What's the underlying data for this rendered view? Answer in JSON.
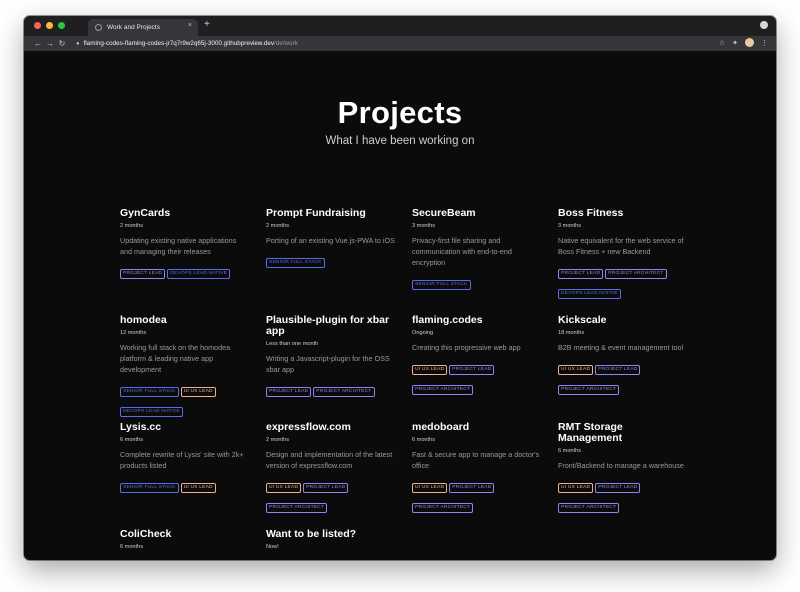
{
  "browser": {
    "tab_title": "Work and Projects",
    "new_tab": "+",
    "tab_close": "×",
    "url_host": "flaming-codes-flaming-codes-jr7q7r9w2q65j-3000.githubpreview.dev",
    "url_path": "/de/work",
    "nav_back": "←",
    "nav_forward": "→",
    "nav_reload": "↻",
    "lock": "🔒",
    "star": "☆",
    "extensions": "✦",
    "menu": "⋮"
  },
  "hero": {
    "title": "Projects",
    "subtitle": "What I have been working on"
  },
  "colors": {
    "tag_blue": "#5b6ce6",
    "tag_orange": "#f0b08a",
    "tag_purple": "#8e86f0"
  },
  "projects": [
    {
      "title": "GynCards",
      "duration": "2 months",
      "description": "Updating existing native applications and managing their releases",
      "tags": [
        {
          "label": "PROJECT LEAD",
          "color": "#8e86f0"
        },
        {
          "label": "DEVOPS LEAD NATIVE",
          "color": "#5b6ce6"
        }
      ]
    },
    {
      "title": "Prompt Fundraising",
      "duration": "2 months",
      "description": "Porting of an existing Vue.js-PWA to iOS",
      "tags": [
        {
          "label": "SENIOR FULL STACK",
          "color": "#5b6ce6"
        }
      ]
    },
    {
      "title": "SecureBeam",
      "duration": "3 months",
      "description": "Privacy-first file sharing and communication with end-to-end encryption",
      "tags": [
        {
          "label": "SENIOR FULL STACK",
          "color": "#5b6ce6"
        }
      ]
    },
    {
      "title": "Boss Fitness",
      "duration": "3 months",
      "description": "Native equivalent for the web service of Boss Fitness + new Backend",
      "tags": [
        {
          "label": "PROJECT LEAD",
          "color": "#8e86f0"
        },
        {
          "label": "PROJECT ARCHITECT",
          "color": "#8e86f0"
        },
        {
          "label": "DEVOPS LEAD NATIVE",
          "color": "#5b6ce6"
        }
      ]
    },
    {
      "title": "homodea",
      "duration": "12 months",
      "description": "Working full stack on the homodea platform & leading native app development",
      "tags": [
        {
          "label": "SENIOR FULL STACK",
          "color": "#5b6ce6"
        },
        {
          "label": "UI UX LEAD",
          "color": "#f0b08a"
        },
        {
          "label": "DEVOPS LEAD NATIVE",
          "color": "#5b6ce6"
        }
      ]
    },
    {
      "title": "Plausible-plugin for xbar app",
      "duration": "Less than one month",
      "description": "Writing a Javascript-plugin for the OSS xbar app",
      "tags": [
        {
          "label": "PROJECT LEAD",
          "color": "#8e86f0"
        },
        {
          "label": "PROJECT ARCHITECT",
          "color": "#8e86f0"
        }
      ]
    },
    {
      "title": "flaming.codes",
      "duration": "Ongoing",
      "description": "Creating this progressive web app",
      "tags": [
        {
          "label": "UI UX LEAD",
          "color": "#f0b08a"
        },
        {
          "label": "PROJECT LEAD",
          "color": "#8e86f0"
        },
        {
          "label": "PROJECT ARCHITECT",
          "color": "#8e86f0"
        }
      ]
    },
    {
      "title": "Kickscale",
      "duration": "18 months",
      "description": "B2B meeting & event management tool",
      "tags": [
        {
          "label": "UI UX LEAD",
          "color": "#f0b08a"
        },
        {
          "label": "PROJECT LEAD",
          "color": "#8e86f0"
        },
        {
          "label": "PROJECT ARCHITECT",
          "color": "#8e86f0"
        }
      ]
    },
    {
      "title": "Lysis.cc",
      "duration": "6 months",
      "description": "Complete rewrite of Lysis' site with 2k+ products listed",
      "tags": [
        {
          "label": "SENIOR FULL STACK",
          "color": "#5b6ce6"
        },
        {
          "label": "UI UX LEAD",
          "color": "#f0b08a"
        }
      ]
    },
    {
      "title": "expressflow.com",
      "duration": "2 months",
      "description": "Design and implementation of the latest version of expressflow.com",
      "tags": [
        {
          "label": "UI UX LEAD",
          "color": "#f0b08a"
        },
        {
          "label": "PROJECT LEAD",
          "color": "#8e86f0"
        },
        {
          "label": "PROJECT ARCHITECT",
          "color": "#8e86f0"
        }
      ]
    },
    {
      "title": "medoboard",
      "duration": "6 months",
      "description": "Fast & secure app to manage a doctor's office",
      "tags": [
        {
          "label": "UI UX LEAD",
          "color": "#f0b08a"
        },
        {
          "label": "PROJECT LEAD",
          "color": "#8e86f0"
        },
        {
          "label": "PROJECT ARCHITECT",
          "color": "#8e86f0"
        }
      ]
    },
    {
      "title": "RMT Storage Management",
      "duration": "6 months",
      "description": "Front/Backend to manage a warehouse",
      "tags": [
        {
          "label": "UI UX LEAD",
          "color": "#f0b08a"
        },
        {
          "label": "PROJECT LEAD",
          "color": "#8e86f0"
        },
        {
          "label": "PROJECT ARCHITECT",
          "color": "#8e86f0"
        }
      ]
    },
    {
      "title": "ColiCheck",
      "duration": "6 months",
      "description": "",
      "tags": []
    },
    {
      "title": "Want to be listed?",
      "duration": "Now!",
      "description": "",
      "tags": []
    }
  ]
}
